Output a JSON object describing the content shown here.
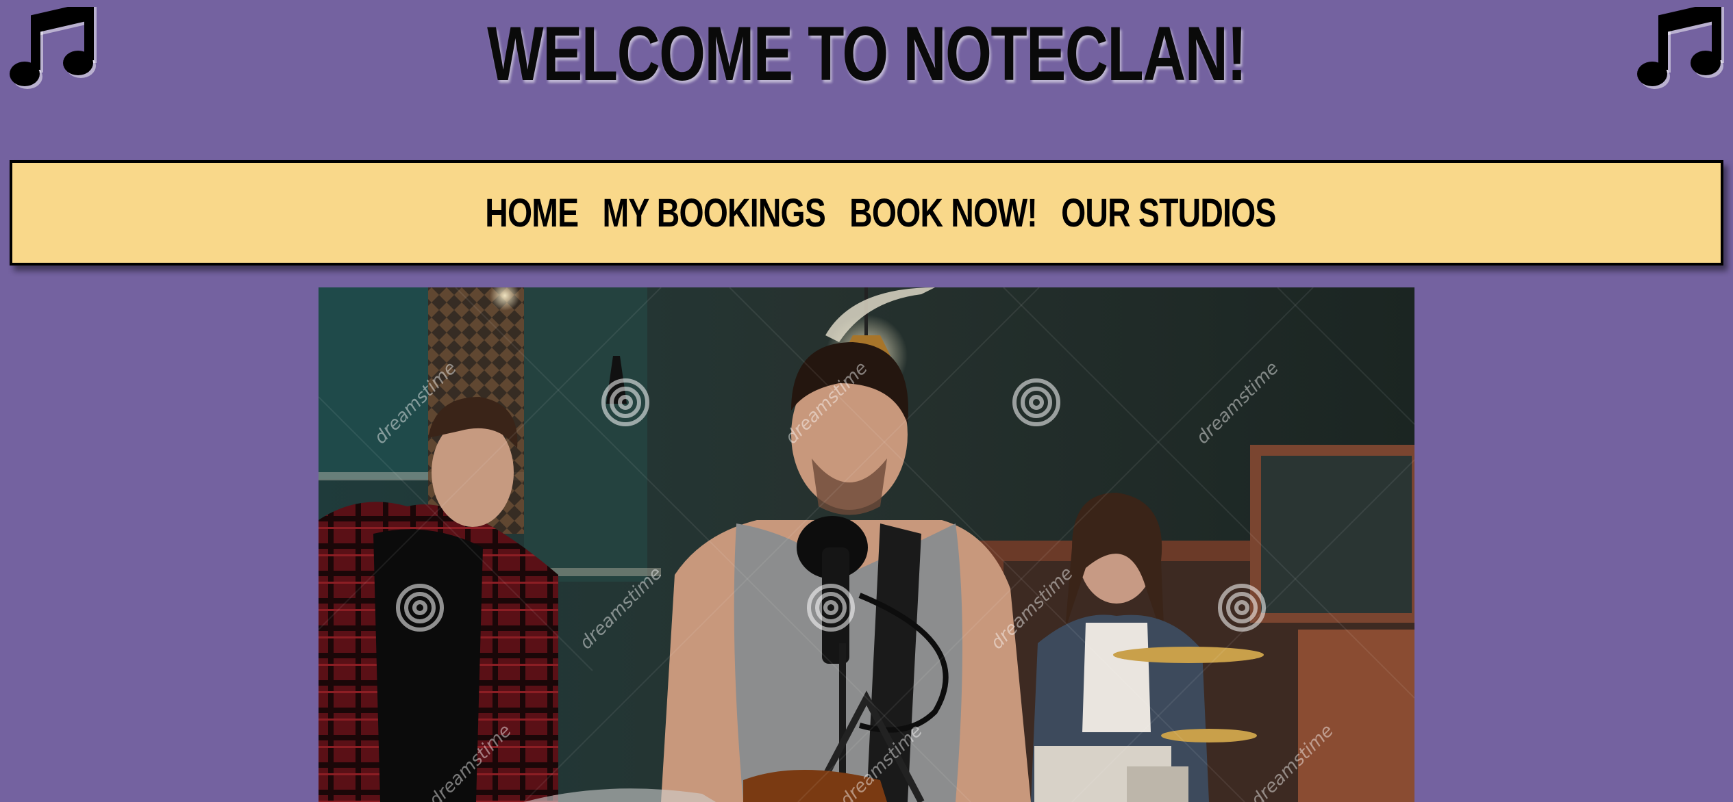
{
  "header": {
    "title": "WELCOME TO NOTECLAN!",
    "left_icon": "music-note-icon",
    "right_icon": "music-note-icon"
  },
  "nav": {
    "links": [
      {
        "label": "HOME"
      },
      {
        "label": "MY BOOKINGS"
      },
      {
        "label": "BOOK NOW!"
      },
      {
        "label": "OUR STUDIOS"
      }
    ]
  },
  "hero": {
    "description": "band-rehearsal-photo",
    "watermark_text": "dreamstime"
  },
  "colors": {
    "page_background": "#7462a0",
    "nav_background": "#f9d88a",
    "text": "#000000"
  }
}
